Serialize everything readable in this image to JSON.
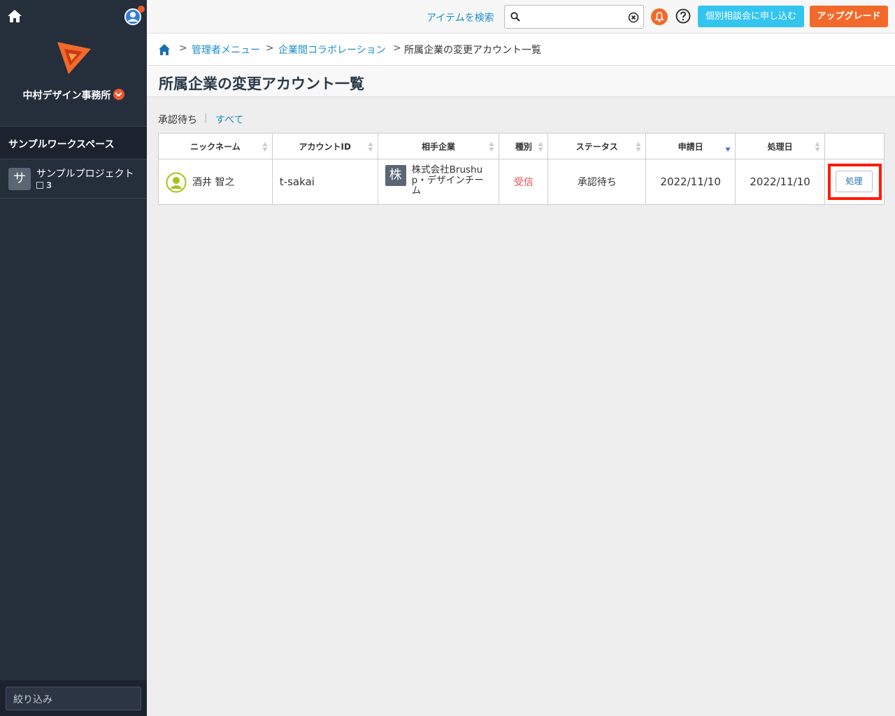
{
  "sidebar": {
    "org_name": "中村デザイン事務所",
    "workspace_title": "サンプルワークスペース",
    "project": {
      "avatar_letter": "サ",
      "name": "サンプルプロジェクト",
      "count": "3"
    },
    "filter_placeholder": "絞り込み"
  },
  "topbar": {
    "search_label": "アイテムを検索",
    "search_value": "",
    "consult_button": "個別相談会に申し込む",
    "upgrade_button": "アップグレード"
  },
  "breadcrumb": {
    "items": [
      "管理者メニュー",
      "企業間コラボレーション"
    ],
    "current": "所属企業の変更アカウント一覧"
  },
  "page": {
    "title": "所属企業の変更アカウント一覧",
    "tabs": {
      "pending": "承認待ち",
      "all": "すべて"
    }
  },
  "table": {
    "headers": [
      "ニックネーム",
      "アカウントID",
      "相手企業",
      "種別",
      "ステータス",
      "申請日",
      "処理日"
    ],
    "rows": [
      {
        "nickname": "酒井 智之",
        "account_id": "t-sakai",
        "company_avatar": "株",
        "company": "株式会社Brushup・デザインチーム",
        "type": "受信",
        "status": "承認待ち",
        "requested": "2022/11/10",
        "processed": "2022/11/10",
        "action": "処理"
      }
    ]
  },
  "colors": {
    "accent": "#1a8fc9",
    "brand_orange": "#f26a2b",
    "consult_blue": "#33c5f0",
    "sidebar_bg": "#252e3b",
    "highlight": "#ff1a0a"
  }
}
